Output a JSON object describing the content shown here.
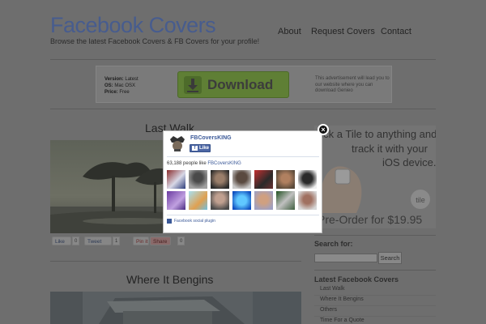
{
  "site": {
    "title": "Facebook Covers",
    "tagline": "Browse the latest Facebook Covers & FB Covers for your profile!"
  },
  "nav": {
    "about": "About",
    "request": "Request Covers",
    "contact": "Contact"
  },
  "ad_banner": {
    "version_label": "Version:",
    "version_value": "Latest",
    "os_label": "OS:",
    "os_value": "Mac OSX",
    "price_label": "Price:",
    "price_value": "Free",
    "download_label": "Download",
    "note": "This advertisement will lead you to our website where you can download Genieo"
  },
  "posts": [
    {
      "title": "Last Walk"
    },
    {
      "title": "Where It Bengins"
    }
  ],
  "share": {
    "fb_like": "Like",
    "fb_count": "0",
    "tweet": "Tweet",
    "tweet_count": "1",
    "pin": "Pin it",
    "share": "Share",
    "share_count": "0"
  },
  "tile_ad": {
    "line1": "Stick a Tile to anything and",
    "line2": "track it with your",
    "line3": "iOS device.",
    "order": "Pre-Order for $19.95"
  },
  "sidebar": {
    "search_heading": "Search for:",
    "search_button": "Search",
    "latest_heading": "Latest Facebook Covers",
    "items": [
      "Last Walk",
      "Where It Bengins",
      "Others",
      "Time For a Quote"
    ]
  },
  "popup": {
    "close": "×",
    "page_name": "FBCoversKING",
    "like_label": "Like",
    "likes_count_text": "63,188 people like",
    "likes_page": "FBCoversKING",
    "plugin_note": "Facebook social plugin"
  },
  "colors": {
    "overlay_bg": "#6e6e6e",
    "title_blue": "#475c8e",
    "facebook_blue": "#3b5998",
    "download_green": "#5f7f35"
  }
}
